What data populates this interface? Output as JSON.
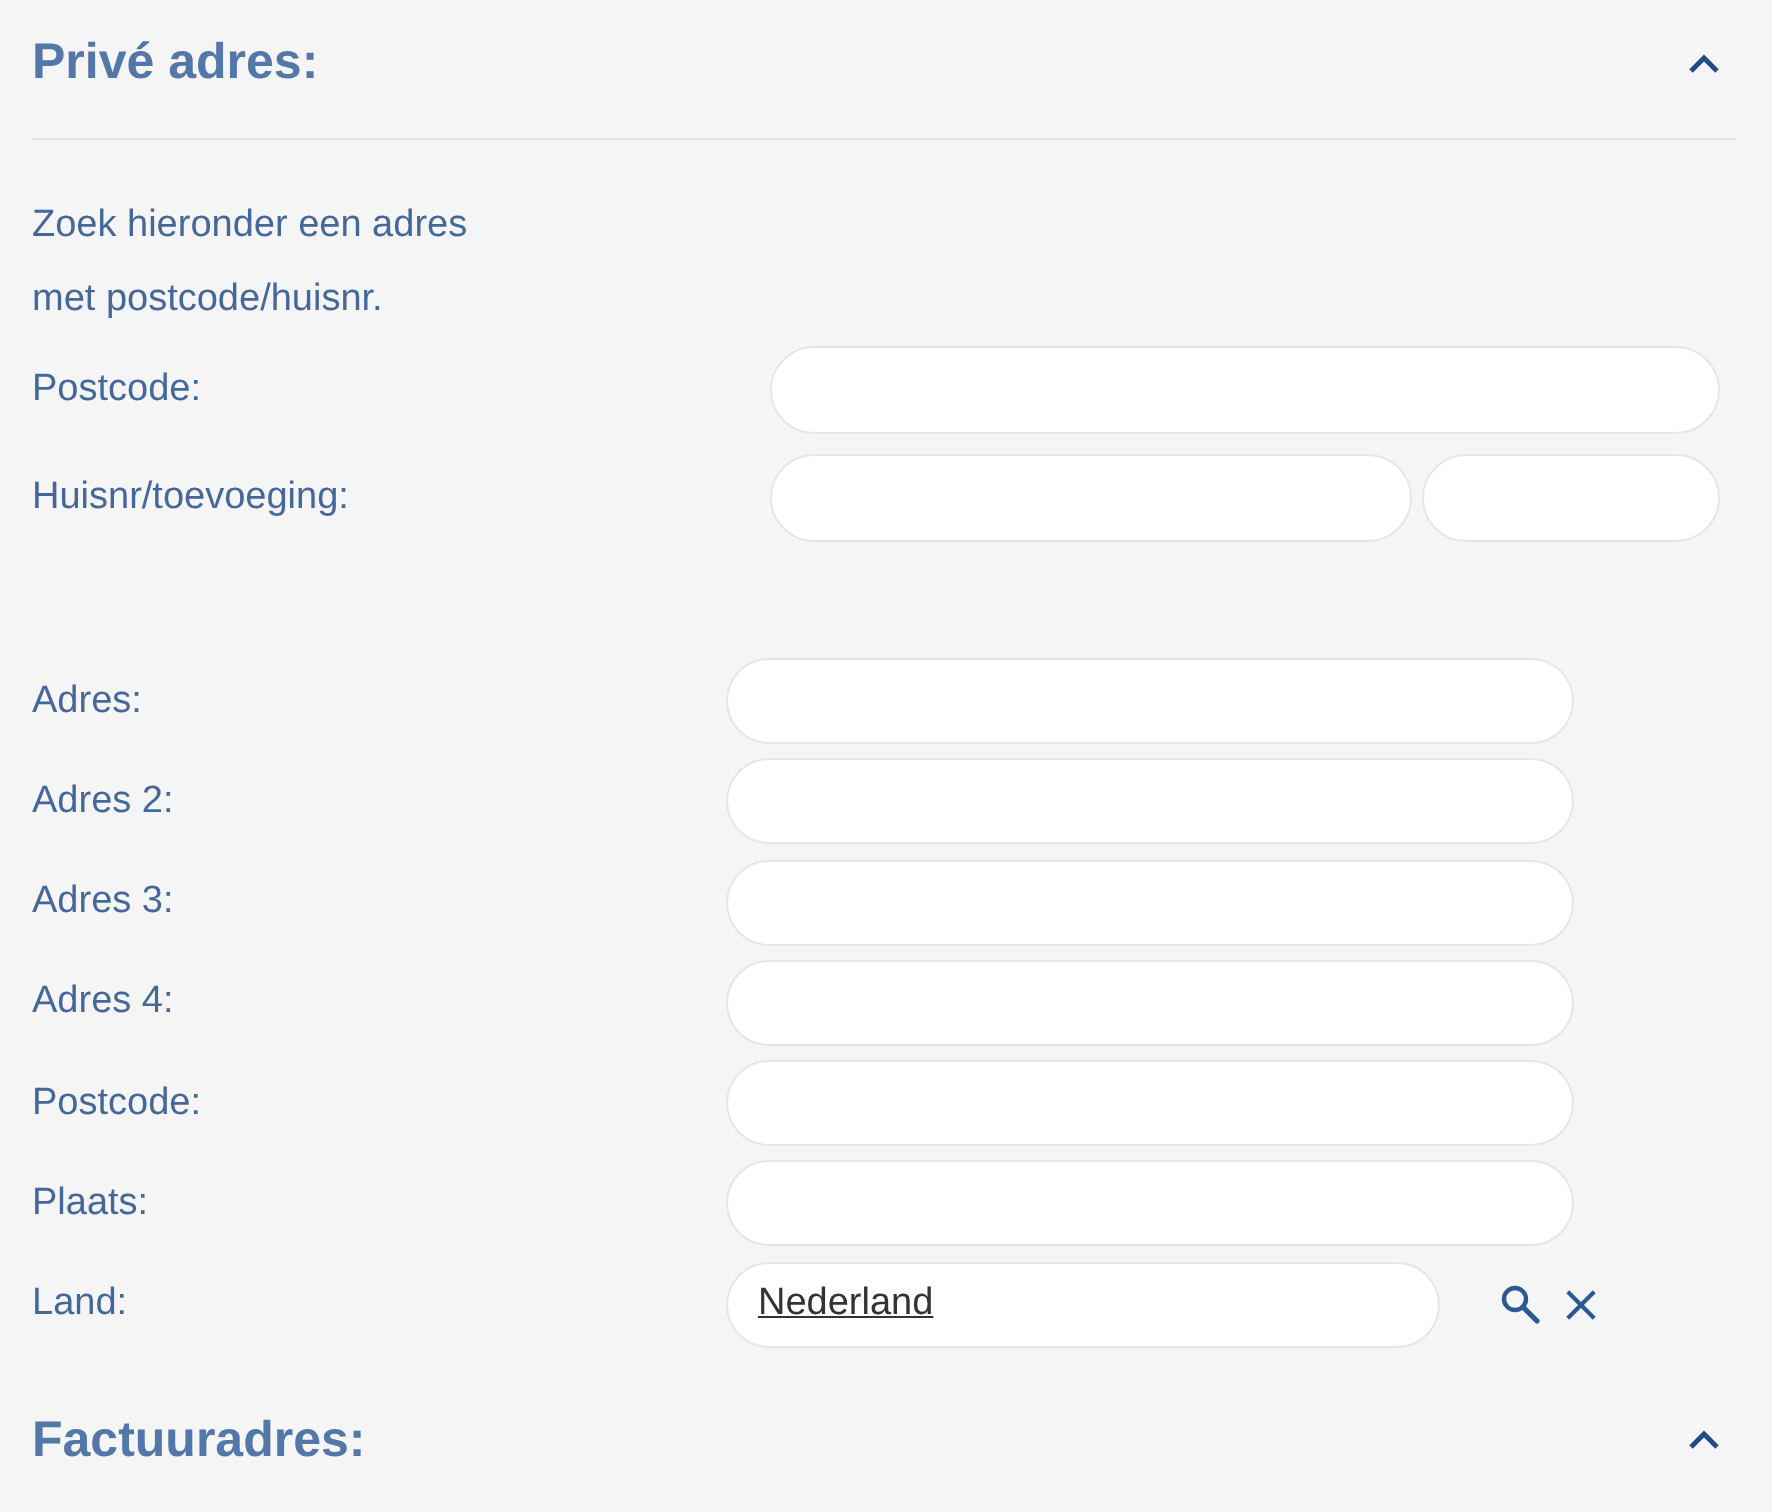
{
  "sections": [
    {
      "title": "Privé adres:",
      "expanded": true,
      "intro": "Zoek hieronder een adres\nmet postcode/huisnr.",
      "search_fields": [
        {
          "label": "Postcode:",
          "kind": "single"
        },
        {
          "label": "Huisnr/toevoeging:",
          "kind": "split"
        }
      ],
      "address_fields": [
        {
          "label": "Adres:",
          "kind": "text"
        },
        {
          "label": "Adres 2:",
          "kind": "text"
        },
        {
          "label": "Adres 3:",
          "kind": "text"
        },
        {
          "label": "Adres 4:",
          "kind": "text"
        },
        {
          "label": "Postcode:",
          "kind": "text"
        },
        {
          "label": "Plaats:",
          "kind": "text"
        },
        {
          "label": "Land:",
          "kind": "lookup",
          "value": "Nederland"
        }
      ]
    },
    {
      "title": "Factuuradres:",
      "expanded": true
    }
  ]
}
